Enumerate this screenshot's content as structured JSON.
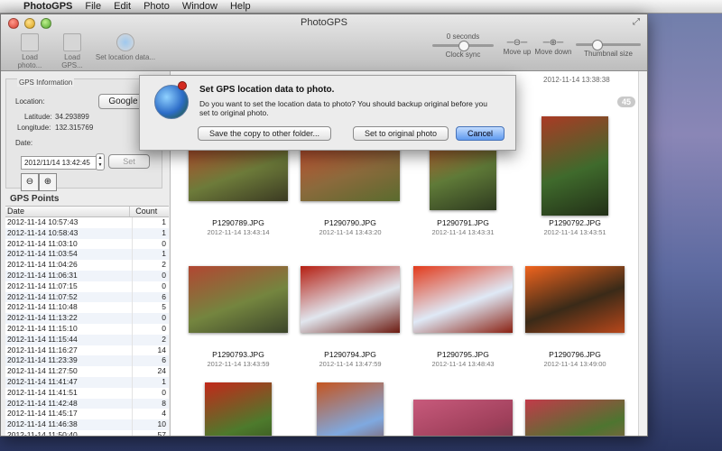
{
  "menubar": {
    "apple": "",
    "app": "PhotoGPS",
    "items": [
      "File",
      "Edit",
      "Photo",
      "Window",
      "Help"
    ]
  },
  "window": {
    "title": "PhotoGPS"
  },
  "toolbar": {
    "load_photo": "Load photo...",
    "load_gps": "Load GPS...",
    "set_location": "Set location data...",
    "clock_value": "0 seconds",
    "clock_label": "Clock sync",
    "move_up": "Move up",
    "move_down": "Move down",
    "thumb_size": "Thumbnail size"
  },
  "gps_info": {
    "header": "GPS Information",
    "location_label": "Location:",
    "google_button": "Google M",
    "latitude_label": "Latitude:",
    "latitude": "34.293899",
    "longitude_label": "Longitude:",
    "longitude": "132.315769",
    "date_label": "Date:",
    "date_value": "2012/11/14 13:42:45",
    "set_button": "Set"
  },
  "gps_points": {
    "title": "GPS Points",
    "col_date": "Date",
    "col_count": "Count",
    "rows": [
      {
        "date": "2012-11-14 10:57:43",
        "count": "1"
      },
      {
        "date": "2012-11-14 10:58:43",
        "count": "1"
      },
      {
        "date": "2012-11-14 11:03:10",
        "count": "0"
      },
      {
        "date": "2012-11-14 11:03:54",
        "count": "1"
      },
      {
        "date": "2012-11-14 11:04:26",
        "count": "2"
      },
      {
        "date": "2012-11-14 11:06:31",
        "count": "0"
      },
      {
        "date": "2012-11-14 11:07:15",
        "count": "0"
      },
      {
        "date": "2012-11-14 11:07:52",
        "count": "6"
      },
      {
        "date": "2012-11-14 11:10:48",
        "count": "5"
      },
      {
        "date": "2012-11-14 11:13:22",
        "count": "0"
      },
      {
        "date": "2012-11-14 11:15:10",
        "count": "0"
      },
      {
        "date": "2012-11-14 11:15:44",
        "count": "2"
      },
      {
        "date": "2012-11-14 11:16:27",
        "count": "14"
      },
      {
        "date": "2012-11-14 11:23:39",
        "count": "6"
      },
      {
        "date": "2012-11-14 11:27:50",
        "count": "24"
      },
      {
        "date": "2012-11-14 11:41:47",
        "count": "1"
      },
      {
        "date": "2012-11-14 11:41:51",
        "count": "0"
      },
      {
        "date": "2012-11-14 11:42:48",
        "count": "8"
      },
      {
        "date": "2012-11-14 11:45:17",
        "count": "4"
      },
      {
        "date": "2012-11-14 11:46:38",
        "count": "10"
      },
      {
        "date": "2012-11-14 11:50:40",
        "count": "57"
      },
      {
        "date": "2012-11-14 12:06:41",
        "count": "184"
      }
    ]
  },
  "photos": {
    "top_date": "2012-11-14 13:38:38",
    "count_badge": "45",
    "items": [
      {
        "name": "P1290789.JPG",
        "date": "2012-11-14 13:43:14",
        "colors": [
          "#c2452a",
          "#6d7b3a",
          "#3b3a22"
        ]
      },
      {
        "name": "P1290790.JPG",
        "date": "2012-11-14 13:43:20",
        "colors": [
          "#c94b2d",
          "#8b6a3c",
          "#5a6b2e"
        ]
      },
      {
        "name": "P1290791.JPG",
        "date": "2012-11-14 13:43:31",
        "colors": [
          "#d2502a",
          "#5f7a38",
          "#2e3a1f"
        ]
      },
      {
        "name": "P1290792.JPG",
        "date": "2012-11-14 13:43:51",
        "colors": [
          "#aa3a25",
          "#3f6a2c",
          "#222f17"
        ]
      },
      {
        "name": "P1290793.JPG",
        "date": "2012-11-14 13:43:59",
        "colors": [
          "#b24632",
          "#74853f",
          "#3c452a"
        ]
      },
      {
        "name": "P1290794.JPG",
        "date": "2012-11-14 13:47:59",
        "colors": [
          "#b51f12",
          "#e1e6ee",
          "#6c1a10"
        ]
      },
      {
        "name": "P1290795.JPG",
        "date": "2012-11-14 13:48:43",
        "colors": [
          "#e23a1b",
          "#dfe9f6",
          "#8a2112"
        ]
      },
      {
        "name": "P1290796.JPG",
        "date": "2012-11-14 13:49:00",
        "colors": [
          "#f0641e",
          "#3a2a18",
          "#b8471a"
        ]
      },
      {
        "name": "",
        "date": "",
        "colors": [
          "#c2281a",
          "#4d7a2c",
          "#2f3f1a"
        ]
      },
      {
        "name": "",
        "date": "",
        "colors": [
          "#c5541f",
          "#7fa9e0",
          "#823018"
        ]
      },
      {
        "name": "",
        "date": "",
        "colors": [
          "#c85a7c",
          "#9e3f5a",
          "#5a3a42"
        ]
      },
      {
        "name": "",
        "date": "",
        "colors": [
          "#c23a4a",
          "#4e7530",
          "#a4564a"
        ]
      }
    ]
  },
  "dialog": {
    "title": "Set GPS location data to photo.",
    "message": "Do you want to set the location data to photo? You should backup original before you set to original photo.",
    "btn_copy": "Save the copy to other folder...",
    "btn_original": "Set to original photo",
    "btn_cancel": "Cancel"
  }
}
